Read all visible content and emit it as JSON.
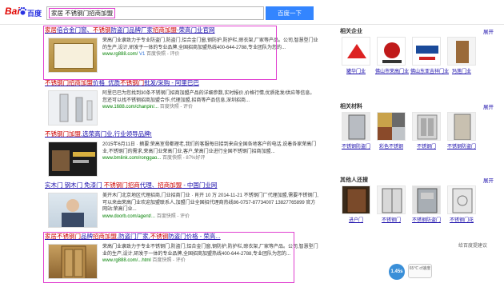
{
  "header": {
    "logo_bai": "Bai",
    "logo_du": "百度",
    "search_value": "家居 不锈钢门招商加盟",
    "search_button": "百度一下"
  },
  "results": [
    {
      "title": "家居倍合金门窗、不锈钢防盗门品牌厂家招商加盟-荣高门业官网",
      "body": "荣高门业隶致力于专业防盗门,防盗门,铝合金门窗,钢防护,防护栏,晾衣架,厂家等产品。公司,智慧型门业的生产,设计,研发于一体的专业品牌,全国招商加盟热线400-644-2788,专业团队为您的...",
      "url": "www.rg888.com/",
      "snapshot": "百度快照 - 评价",
      "v_badge": "V1"
    },
    {
      "title": "不锈钢门招商加盟价格_优质不锈钢门批发/采购 - 阿里巴巴",
      "body": "阿里巴巴为您找到30条不锈钢门招商加盟产品的详细参数,实时报价,价格行情,优质批发/供应等信息。您还可以找不锈钢招商加盟合作,代理加盟,招商等产品信息,深圳招商...",
      "url": "www.1688.com/chanpin/...",
      "snapshot": "百度快照 - 评价"
    },
    {
      "title": "不锈钢门加盟,选荣高门业,行业领导品牌!",
      "body": "2015年6月11日 · 摘要:荣高室骨都理老,我们的客服每日接到来自全国各地客户的电话,说着各家荣高门业,不锈钢门的需求,荣高门业荣高门业,客户,荣高门业进行全国不锈钢门招商加盟...",
      "url": "www.bmlink.com/ronggao...",
      "snapshot": "百度快照 - 87%好评"
    },
    {
      "title": "实木门 钢木门 免漆门 不锈钢门招商代理、招商加盟 - 中国门业网",
      "body": "美开木门北京地区代理招商,门业招商门业 · 肖开 10 万 2014-11-21 不锈钢门厂代理加盟,需要不锈钢门,可以来由荣高门业欢迎加盟联系人,加盟门业全国招代理商热线86-0757-87734007 13827765899 官方网站:荣高门业...",
      "url": "www.doorb.com/agent/...",
      "snapshot": "百度快照 - 评价"
    },
    {
      "title": "家居不锈钢门品牌招商加盟,防盗门厂家,不锈钢防盗门价格 - 荣高...",
      "body": "荣高门业隶致力于专业不锈钢门,防盗门,铝合金门窗,钢防护,防护栏,晾衣架,厂家等产品。公司,智慧型门业的生产,设计,研发于一体的专业品牌,全国招商加盟热线400-644-2788,专业团队为您的...",
      "url": "www.rg888.com/...html",
      "snapshot": "百度快照 - 评价"
    }
  ],
  "sidebar": {
    "sections": [
      {
        "heading": "相关企业",
        "more": "展开",
        "items": [
          "罐华门业",
          "佛山市荣高门业",
          "佛山东亚吉祥门业",
          "玛莲门业"
        ]
      },
      {
        "heading": "相关材料",
        "more": "展开",
        "items": [
          "不锈钢防盗门",
          "彩色不锈钢",
          "不锈钢门",
          "不锈钢防盗门"
        ]
      },
      {
        "heading": "其他人还搜",
        "more": "展开",
        "items": [
          "进户门",
          "不锈钢门",
          "不锈钢防盗门",
          "不锈钢门花"
        ]
      }
    ],
    "feedback": "给百度提建议",
    "badge": "1.45s",
    "speed_text": "65℃ cf速度"
  },
  "colors": {
    "link": "#1a0dab",
    "highlight": "#cc0000",
    "url": "#008000",
    "button": "#3385ff",
    "annotation": "#e040d0"
  }
}
